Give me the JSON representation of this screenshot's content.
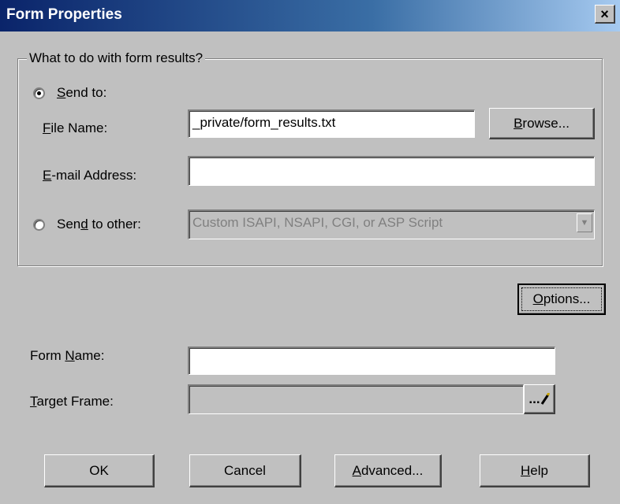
{
  "window": {
    "title": "Form Properties",
    "close_glyph": "×"
  },
  "group": {
    "legend": "What to do with form results?"
  },
  "send_to": {
    "label_underlined": "S",
    "label_rest": "end to:",
    "selected": true
  },
  "file_name": {
    "label_underlined": "F",
    "label_rest": "ile Name:",
    "value": "_private/form_results.txt"
  },
  "browse": {
    "label_underlined": "B",
    "label_rest": "rowse..."
  },
  "email": {
    "label_underlined": "E",
    "label_rest": "-mail Address:",
    "value": ""
  },
  "send_other": {
    "label_pre": "Sen",
    "label_underlined": "d",
    "label_rest": " to other:",
    "selected": false,
    "value": "Custom ISAPI, NSAPI, CGI, or ASP Script"
  },
  "options": {
    "label_underlined": "O",
    "label_rest": "ptions..."
  },
  "form_name": {
    "label_pre": "Form ",
    "label_underlined": "N",
    "label_rest": "ame:",
    "value": ""
  },
  "target_frame": {
    "label_underlined": "T",
    "label_rest": "arget Frame:",
    "value": "",
    "button_glyph": "..."
  },
  "buttons": {
    "ok": "OK",
    "cancel": "Cancel",
    "advanced_underlined": "A",
    "advanced_rest": "dvanced...",
    "help_underlined": "H",
    "help_rest": "elp"
  }
}
